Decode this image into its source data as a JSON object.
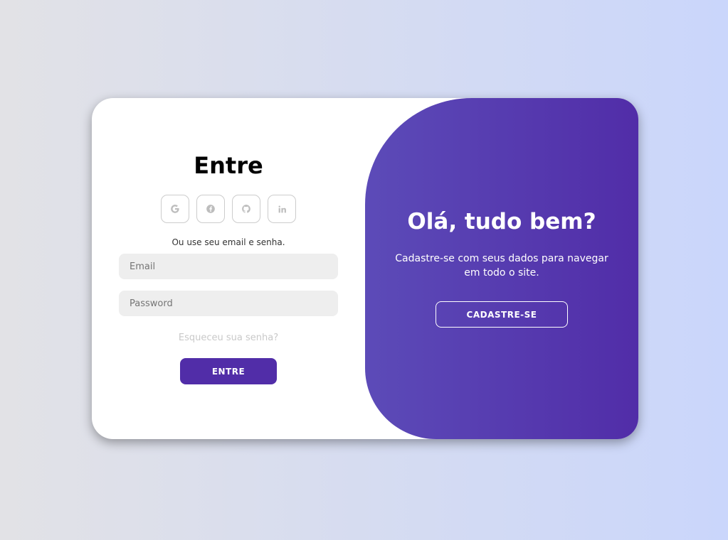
{
  "signin": {
    "title": "Entre",
    "social": [
      {
        "icon": "google-icon",
        "glyph": "G"
      },
      {
        "icon": "facebook-icon",
        "glyph": "f"
      },
      {
        "icon": "github-icon",
        "glyph": "⌥"
      },
      {
        "icon": "linkedin-icon",
        "glyph": "in"
      }
    ],
    "subtext": "Ou use seu email e senha.",
    "email": {
      "value": "",
      "placeholder": "Email"
    },
    "password": {
      "value": "",
      "placeholder": "Password"
    },
    "forgot_label": "Esqueceu sua senha?",
    "submit_label": "ENTRE"
  },
  "toggle": {
    "title": "Olá, tudo bem?",
    "text": "Cadastre-se com seus dados para navegar em todo o site.",
    "button_label": "CADASTRE-SE"
  },
  "colors": {
    "accent": "#512da8",
    "gradient_start": "#5c4bb8",
    "input_bg": "#eeeeee"
  }
}
